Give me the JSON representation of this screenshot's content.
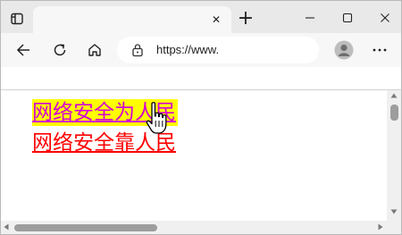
{
  "tabstrip": {
    "tab_close_glyph": "✕",
    "new_tab_glyph": "+",
    "icons": [
      "tab-actions-icon",
      "close-icon",
      "plus-icon",
      "minimize-icon",
      "maximize-icon",
      "window-close-icon"
    ]
  },
  "toolbar": {
    "url": "https://www.",
    "icons": [
      "back-arrow-icon",
      "refresh-icon",
      "home-icon",
      "lock-icon",
      "profile-icon",
      "more-icon"
    ]
  },
  "content": {
    "links": [
      {
        "text": "网络安全为人民",
        "color": "#d400d4",
        "highlight": "#ffff00"
      },
      {
        "text": "网络安全靠人民",
        "color": "#ff0000"
      }
    ]
  },
  "cursor": "hand-pointer-icon"
}
